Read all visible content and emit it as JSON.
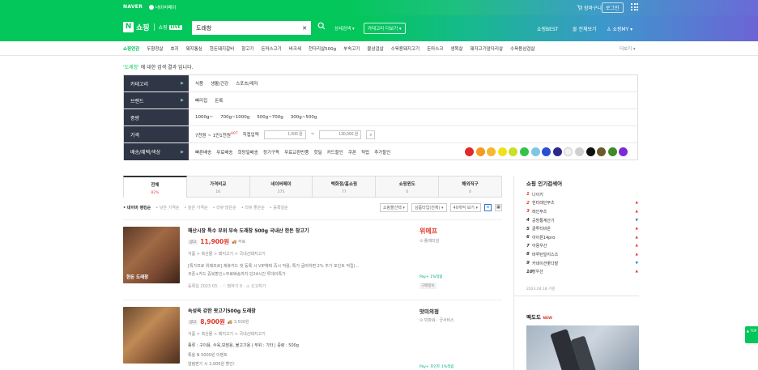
{
  "topbar": {
    "naver": "NAVER",
    "naverpay": "네이버페이",
    "cart": "장바구니",
    "login": "로그인"
  },
  "header": {
    "logo_n": "N",
    "logo_text": "쇼핑",
    "live_prefix": "쇼핑",
    "live_badge": "LIVE",
    "search_value": "도래창",
    "detail_search": "상세검색 ▾",
    "category_more": "카테고리 더보기 ▾",
    "shopping_best": "쇼핑BEST",
    "view_all": "몰 전체보기",
    "my_shopping": "쇼핑MY ▾"
  },
  "catnav": {
    "items": [
      "쇼핑연관",
      "두향정살",
      "호지",
      "돼지통심",
      "한돈돼지갈비",
      "항고기",
      "돈마스고기",
      "바크세",
      "천다리살500g",
      "부속고기",
      "불삼겹살",
      "수육용돼지고기",
      "돈마스크",
      "생목살",
      "돼지고기앞다리살",
      "수육용삼겹살"
    ],
    "more": "더보기 ▾"
  },
  "result_msg": {
    "query": "'도래창'",
    "text": " 에 대한 검색 결과 입니다."
  },
  "filter": {
    "rows": [
      {
        "label": "카테고리",
        "options": [
          "식품",
          "생활/건강",
          "스포츠/레저"
        ]
      },
      {
        "label": "브랜드",
        "options": [
          "빠리집",
          "돈록"
        ]
      },
      {
        "label": "중량",
        "options": [
          "1000g~",
          "700g~1000g",
          "500g~700g",
          "300g~500g"
        ]
      },
      {
        "label": "가격",
        "options": [
          "7천원 ~ 1만1천원",
          "직접입력"
        ]
      },
      {
        "label": "배송/혜택/색상",
        "options": [
          "빠른배송",
          "무료배송",
          "희망일배송",
          "정기구독",
          "무료교환반품",
          "핫딜",
          "카드할인",
          "쿠폰",
          "적립",
          "추가할인"
        ]
      }
    ],
    "price_min": "1,000 원",
    "price_max": "130,000 원",
    "hot": "HOT",
    "colors": [
      "#e02a2a",
      "#f39c1f",
      "#f5b82e",
      "#f2e01d",
      "#c8e02a",
      "#37c14a",
      "#7fc6e6",
      "#2a4fd1",
      "#2a2a8a",
      "#f2f2f2",
      "#cfcfcf",
      "#111111",
      "#6b5a2a",
      "#3f8a2a",
      "#7c2ad1"
    ]
  },
  "tabs": [
    {
      "label": "전체",
      "count": "82%"
    },
    {
      "label": "가격비교",
      "count": "16"
    },
    {
      "label": "네이버페이",
      "count": "275"
    },
    {
      "label": "백화점/홈쇼핑",
      "count": "77"
    },
    {
      "label": "쇼핑윈도",
      "count": "0"
    },
    {
      "label": "해외직구",
      "count": "0"
    }
  ],
  "sortbar": {
    "options": [
      "• 네이버 랭킹순",
      "• 낮은 가격순",
      "• 높은 가격순",
      "• 리뷰 많은순",
      "• 리뷰 좋은순",
      "• 등록일순"
    ],
    "select1": "쇼핑몰선택 ▾",
    "select2": "상품타입(전체) ▾",
    "select3": "40개씩 보기 ▾"
  },
  "items": [
    {
      "title": "해산시장 특수 부위 부속 도래창 500g 국내산 한돈 창고기",
      "badge": "광고",
      "price": "11,900원",
      "ship": "무료",
      "path": "식품 > 축산물 > 돼지고기 > 국내산돼지고기",
      "desc1": "[특가프로 위메프로] 제휴카드 첫 등록 시 VIP혜택 즉시 적용, 특가 굴러하면 2% 추가 포인트 적립(...",
      "desc2": "쿠폰+카드 중복할인+무료배송까지 단24시간 투데이특가",
      "meta": "등록일 2023.03.   ·   ♡ 찜하기 0   ·   ⚠ 신고하기",
      "thumb_cap": "한돈 도래창",
      "mall_name": "위메프",
      "mall_sub": "⊙ 플래티넘",
      "npay": "Pay+ 1%적립",
      "purchase": "구매정보"
    },
    {
      "title": "속성육 강한 팟고기500g 도래창",
      "badge": "광고",
      "price": "8,900원",
      "ship": "3,500원",
      "path": "식품 > 축산물 > 돼지고기 > 국내산돼지고기",
      "desc1": "종류 : 구이용, 수육,보쌈용, 불고기용  |  부위 : 기타  |  중량 : 500g",
      "desc2": "톡을 N 5000원 이벤트",
      "desc3": "알림받기 시 2,000원 할인!",
      "thumb_cap": "",
      "mall_name": "맛미의정",
      "mall_sub": "⊙ 빅파워  ·  굿서비스",
      "npay": "Pay+ 포인트 1%적립"
    }
  ],
  "side": {
    "title": "쇼핑 인기검색어",
    "ranks": [
      {
        "n": "1",
        "text": "나이키",
        "status": "same"
      },
      {
        "n": "2",
        "text": "헌터레인부츠",
        "status": "up"
      },
      {
        "n": "3",
        "text": "레인부츠",
        "status": "up"
      },
      {
        "n": "4",
        "text": "공방통계산기",
        "status": "down"
      },
      {
        "n": "5",
        "text": "골투티비온",
        "status": "up"
      },
      {
        "n": "6",
        "text": "아이폰14pro",
        "status": "up"
      },
      {
        "n": "7",
        "text": "아몽우산",
        "status": "up"
      },
      {
        "n": "8",
        "text": "바루턴일지스즈",
        "status": "up"
      },
      {
        "n": "9",
        "text": "카네이션꽃다발",
        "status": "down"
      },
      {
        "n": "10",
        "text": "장우산",
        "status": "up"
      }
    ],
    "basis": "2023.04.18 기준",
    "ad_title": "맥도도",
    "ad_new": "NEW"
  },
  "top_btn": "▲ TOP"
}
